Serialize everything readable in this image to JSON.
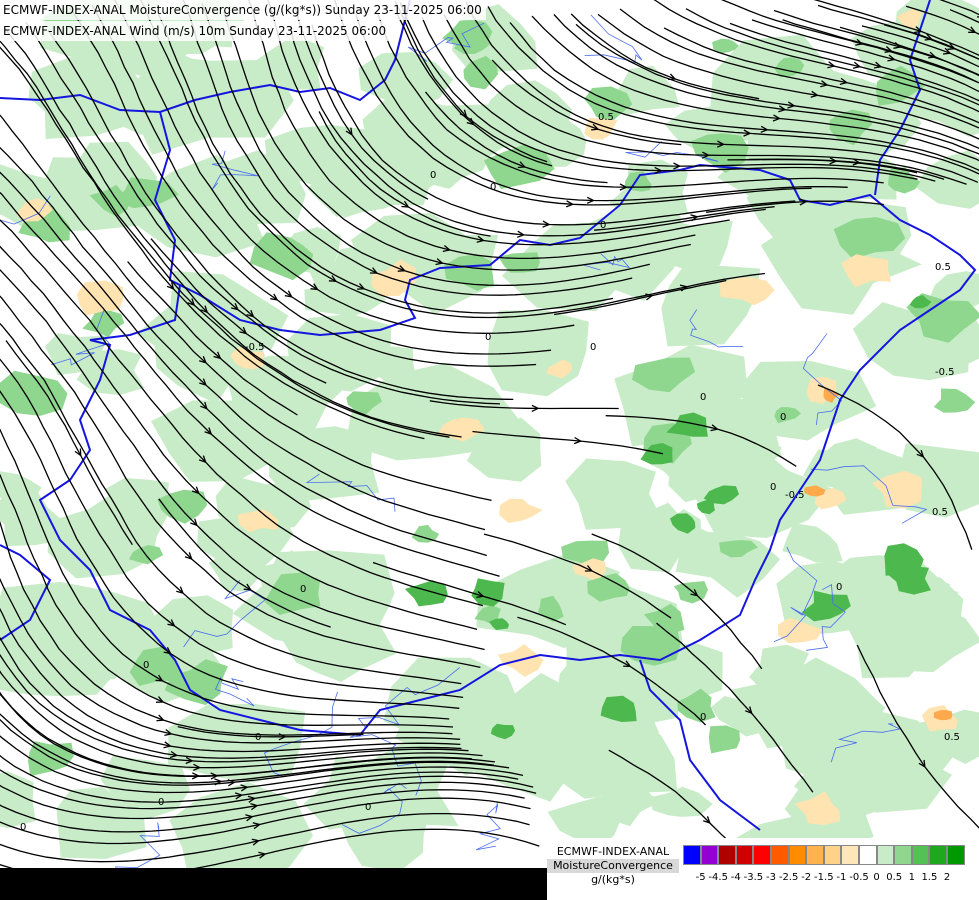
{
  "titles": {
    "line1": "ECMWF-INDEX-ANAL MoistureConvergence (g/(kg*s)) Sunday 23-11-2025 06:00",
    "line2": "ECMWF-INDEX-ANAL Wind (m/s) 10m Sunday 23-11-2025 06:00"
  },
  "legend": {
    "model": "ECMWF-INDEX-ANAL",
    "variable": "MoistureConvergence",
    "unit": "g/(kg*s)",
    "tick_labels": [
      "-5",
      "-4.5",
      "-4",
      "-3.5",
      "-3",
      "-2.5",
      "-2",
      "-1.5",
      "-1",
      "-0.5",
      "0",
      "0.5",
      "1",
      "1.5",
      "2"
    ],
    "colors": [
      "#0000ff",
      "#9400d3",
      "#b00000",
      "#d00000",
      "#ff0000",
      "#ff5a00",
      "#ff8c00",
      "#ffb24d",
      "#ffd28a",
      "#ffe6b8",
      "#ffffff",
      "#c7ecc7",
      "#8fd68f",
      "#55c055",
      "#1fa81f",
      "#009900"
    ]
  },
  "contour_labels": [
    "0.5",
    "0",
    "0",
    "0",
    "0",
    "0",
    "0",
    "0",
    "0",
    "-0.5",
    "0.5",
    "-0.5",
    "0.5",
    "-0.5",
    "0",
    "0",
    "0",
    "0",
    "0",
    "0.5",
    "0",
    "0",
    "0"
  ],
  "colors": {
    "green_light": "#c7ecc7",
    "green_mid": "#8fd68f",
    "green_dark": "#4db84d",
    "orange_light": "#ffe3b0",
    "orange_dark": "#ffa94d",
    "border": "#1515e0",
    "river": "#4a6cf0",
    "streamline": "#000000"
  }
}
